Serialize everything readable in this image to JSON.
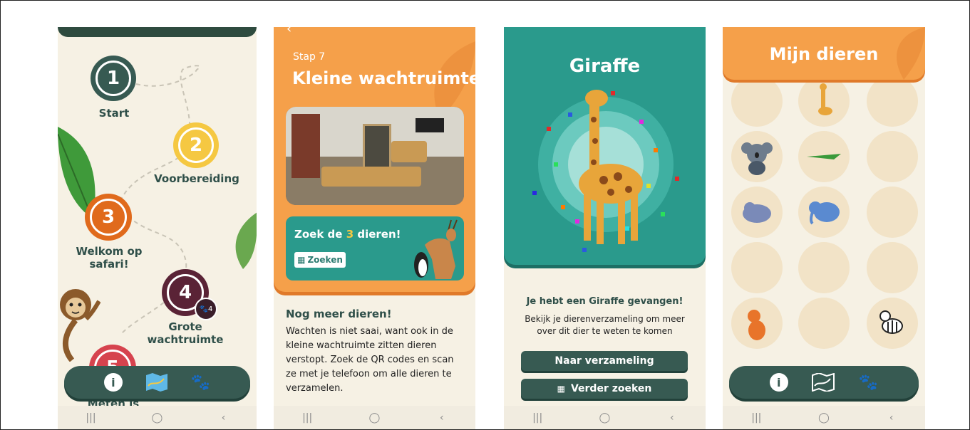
{
  "screen1": {
    "steps": [
      {
        "number": "1",
        "label": "Start"
      },
      {
        "number": "2",
        "label": "Voorbereiding"
      },
      {
        "number": "3",
        "label": "Welkom op safari!"
      },
      {
        "number": "4",
        "label": "Grote wachtruimte",
        "badge": "4"
      },
      {
        "number": "5",
        "label": "Meten is"
      }
    ]
  },
  "screen2": {
    "step_label": "Stap 7",
    "title": "Kleine wachtruimte",
    "search_card_prefix": "Zoek de ",
    "search_card_count": "3",
    "search_card_suffix": " dieren!",
    "search_button": "Zoeken",
    "heading": "Nog meer dieren!",
    "body": "Wachten is niet saai, want ook in de kleine wachtruimte zitten dieren verstopt. Zoek de QR codes en scan ze met je telefoon om alle dieren te verzamelen."
  },
  "screen3": {
    "animal_name": "Giraffe",
    "caught_text": "Je hebt een Giraffe gevangen!",
    "description": "Bekijk je dierenverzameling om meer over dit dier te weten te komen",
    "collection_button": "Naar verzameling",
    "search_more_button": "Verder zoeken"
  },
  "screen4": {
    "title": "Mijn dieren"
  },
  "colors": {
    "orange": "#f5a04a",
    "teal": "#2a9a8c",
    "dark_green": "#375a52",
    "cream": "#f6f1e4",
    "yellow": "#f5c842"
  },
  "icons": [
    "info-icon",
    "map-icon",
    "paw-icon",
    "qr-icon",
    "recents-icon",
    "home-icon",
    "back-icon"
  ]
}
